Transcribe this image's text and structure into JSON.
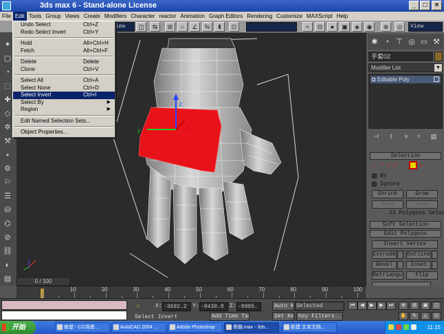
{
  "window": {
    "title": "3ds max 6 - Stand-alone License",
    "min": "_",
    "max": "□",
    "close": "×"
  },
  "menus": [
    "File",
    "Edit",
    "Tools",
    "Group",
    "Views",
    "Create",
    "Modifiers",
    "Character",
    "reactor",
    "Animation",
    "Graph Editors",
    "Rendering",
    "Customize",
    "MAXScript",
    "Help"
  ],
  "active_menu": "Edit",
  "edit_menu": [
    {
      "label": "Undo Select",
      "shortcut": "Ctrl+Z"
    },
    {
      "label": "Redo Select Invert",
      "shortcut": "Ctrl+Y"
    },
    {
      "sep": true
    },
    {
      "label": "Hold",
      "shortcut": "Alt+Ctrl+H"
    },
    {
      "label": "Fetch",
      "shortcut": "Alt+Ctrl+F"
    },
    {
      "sep": true
    },
    {
      "label": "Delete",
      "shortcut": "Delete"
    },
    {
      "label": "Clone",
      "shortcut": "Ctrl+V"
    },
    {
      "sep": true
    },
    {
      "label": "Select All",
      "shortcut": "Ctrl+A"
    },
    {
      "label": "Select None",
      "shortcut": "Ctrl+D"
    },
    {
      "label": "Select Invert",
      "shortcut": "Ctrl+I",
      "selected": true
    },
    {
      "label": "Select By",
      "submenu": true
    },
    {
      "label": "Region",
      "submenu": true
    },
    {
      "sep": true
    },
    {
      "label": "Edit Named Selection Sets..."
    },
    {
      "sep": true
    },
    {
      "label": "Object Properties..."
    }
  ],
  "toolbar": {
    "view_select": "View",
    "view_select_right": "View"
  },
  "viewport": {
    "axis_labels": {
      "x": "x",
      "y": "y",
      "z": "z"
    },
    "accent": "#e8121a"
  },
  "right_panel": {
    "object_name": "手套02",
    "modifier_list": "Modifier List",
    "stack_item": "Editable Poly",
    "selection_title": "Selection",
    "by_label": "By",
    "ignore_label": "Ignore",
    "shrink": "Shrink",
    "grow": "Grow",
    "ring": "Ring",
    "loop": "Loop",
    "selected_count": "23 Polygons Selected",
    "soft_selection": "Soft Selection",
    "edit_polygons": "Edit Polygons",
    "insert_vertex": "Insert Vertex",
    "extrude": "Extrude",
    "outline": "Outline",
    "bevel": "Bevel",
    "inset": "Inset",
    "retriangulate": "Retriangula",
    "flip": "Flip",
    "hinge": "Hinge From Edge",
    "extrude_spline": "Extrude Along Spline"
  },
  "timeline": {
    "frame_display": "0 / 100",
    "ticks": [
      "10",
      "20",
      "30",
      "40",
      "50",
      "60",
      "70",
      "80",
      "90",
      "100"
    ]
  },
  "status": {
    "prompt": "Select Invert",
    "add_time_tag": "Add Time Tag",
    "x_label": "X:",
    "x_value": "-3692.2",
    "y_label": "Y:",
    "y_value": "-9430.8",
    "z_label": "Z:",
    "z_value": "-8905.",
    "auto_key": "Auto Key",
    "set_key": "Set Key",
    "selected": "Selected",
    "key_filters": "Key Filters..."
  },
  "taskbar": {
    "start": "开始",
    "tasks": [
      "绝望 - CG场景...",
      "AutoCAD 2004 ...",
      "Adobe Photoshop",
      "骨骼.max - 3ds...",
      "新建 文本文档..."
    ],
    "clock": "11:15"
  }
}
